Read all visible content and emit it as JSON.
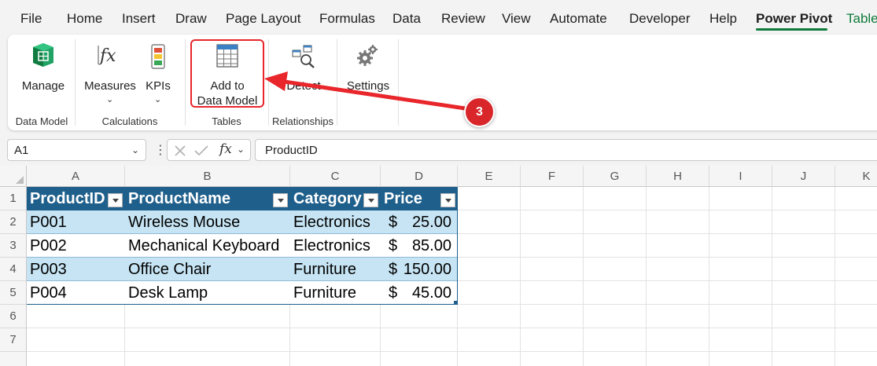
{
  "menu": {
    "items": [
      "File",
      "Home",
      "Insert",
      "Draw",
      "Page Layout",
      "Formulas",
      "Data",
      "Review",
      "View",
      "Automate",
      "Developer",
      "Help",
      "Power Pivot",
      "Table"
    ],
    "active": "Power Pivot"
  },
  "ribbon": {
    "manage_label": "Manage",
    "measures_label": "Measures",
    "kpis_label": "KPIs",
    "add_to_label_line1": "Add to",
    "add_to_label_line2": "Data Model",
    "detect_label": "Detect",
    "settings_label": "Settings",
    "groups": {
      "data_model": "Data Model",
      "calculations": "Calculations",
      "tables": "Tables",
      "relationships": "Relationships"
    }
  },
  "callout": {
    "step": "3"
  },
  "formula_bar": {
    "name_box": "A1",
    "formula": "ProductID"
  },
  "grid": {
    "columns": [
      "A",
      "B",
      "C",
      "D",
      "E",
      "F",
      "G",
      "H",
      "I",
      "J",
      "K"
    ],
    "rows": [
      "1",
      "2",
      "3",
      "4",
      "5",
      "6",
      "7"
    ]
  },
  "table": {
    "headers": [
      "ProductID",
      "ProductName",
      "Category",
      "Price"
    ],
    "currency_symbol": "$",
    "rows": [
      {
        "id": "P001",
        "name": "Wireless Mouse",
        "category": "Electronics",
        "price": "25.00"
      },
      {
        "id": "P002",
        "name": "Mechanical Keyboard",
        "category": "Electronics",
        "price": "85.00"
      },
      {
        "id": "P003",
        "name": "Office Chair",
        "category": "Furniture",
        "price": "150.00"
      },
      {
        "id": "P004",
        "name": "Desk Lamp",
        "category": "Furniture",
        "price": "45.00"
      }
    ]
  },
  "colors": {
    "header_fill": "#1f5f8b",
    "band_fill": "#c6e4f3",
    "accent_green": "#0e7a3a",
    "highlight_red": "#e8262b"
  }
}
